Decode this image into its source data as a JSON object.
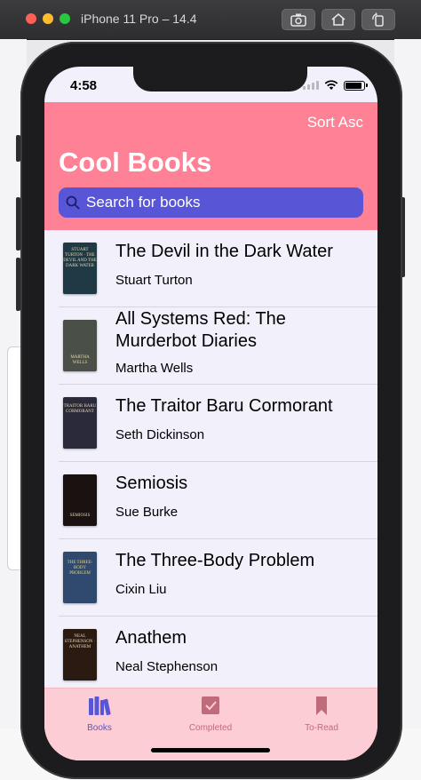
{
  "simulator": {
    "title": "iPhone 11 Pro – 14.4"
  },
  "status_bar": {
    "time": "4:58"
  },
  "header": {
    "sort_label": "Sort Asc",
    "title": "Cool Books",
    "search_placeholder": "Search for books"
  },
  "books": [
    {
      "title": "The Devil in the Dark Water",
      "author": "Stuart Turton",
      "cover_text": "STUART TURTON · THE DEVIL AND THE DARK WATER",
      "cover_color": "#1f3a44"
    },
    {
      "title": "All Systems Red: The Murderbot Diaries",
      "author": "Martha Wells",
      "cover_text": "MARTHA WELLS",
      "cover_color": "#4a5048"
    },
    {
      "title": "The Traitor Baru Cormorant",
      "author": "Seth Dickinson",
      "cover_text": "TRAITOR BARU CORMORANT",
      "cover_color": "#2b2a3a"
    },
    {
      "title": "Semiosis",
      "author": "Sue Burke",
      "cover_text": "SEMIOSIS",
      "cover_color": "#1a1210"
    },
    {
      "title": "The Three-Body Problem",
      "author": "Cixin Liu",
      "cover_text": "THE THREE-BODY PROBLEM",
      "cover_color": "#2f4a6e"
    },
    {
      "title": "Anathem",
      "author": "Neal Stephenson",
      "cover_text": "NEAL STEPHENSON · ANATHEM",
      "cover_color": "#2a1a12"
    }
  ],
  "tabs": [
    {
      "label": "Books",
      "icon": "books-icon",
      "selected": true,
      "color": "#5856d6"
    },
    {
      "label": "Completed",
      "icon": "checkmark-square-icon",
      "selected": false,
      "color": "#c06b7c"
    },
    {
      "label": "To-Read",
      "icon": "bookmark-icon",
      "selected": false,
      "color": "#c06b7c"
    }
  ],
  "colors": {
    "header_bg": "#ff8196",
    "search_bg": "#5856d6",
    "list_bg": "#f1f0fb",
    "tabbar_bg": "#fccdd5",
    "accent": "#5856d6"
  }
}
